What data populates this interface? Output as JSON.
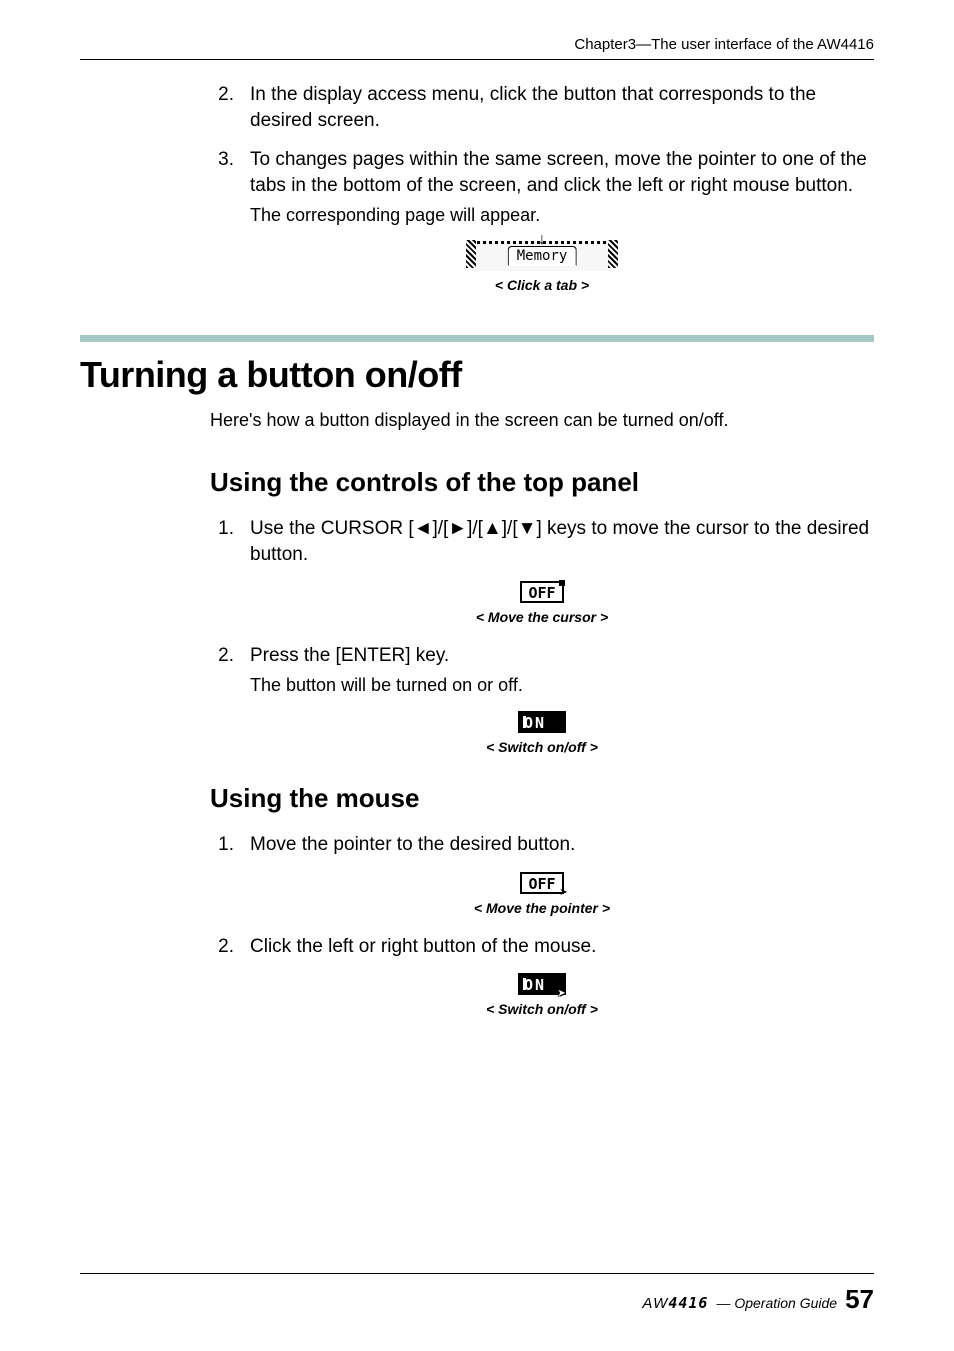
{
  "header": {
    "chapter": "Chapter3—The user interface of the AW4416"
  },
  "pre_steps": [
    {
      "num": "2.",
      "text": "In the display access menu, click the button that corresponds to the desired screen."
    },
    {
      "num": "3.",
      "text": "To changes pages within the same screen, move the pointer to one of the tabs in the bottom of the screen, and click the left or right mouse button.",
      "sub": "The corresponding page will appear."
    }
  ],
  "fig_tab": {
    "label": "Memory",
    "caption": "< Click a tab >"
  },
  "section": {
    "title": "Turning a button on/off",
    "intro": "Here's how a button displayed in the screen can be turned on/off."
  },
  "sub1": {
    "title": "Using the controls of the top panel",
    "steps": [
      {
        "num": "1.",
        "pre": "Use the CURSOR [",
        "mid": "]/[",
        "mid2": "]/[",
        "mid3": "]/[",
        "post": "] keys to move the cursor to the desired button."
      },
      {
        "num": "2.",
        "text": "Press the [ENTER] key.",
        "sub": "The button will be turned on or off."
      }
    ],
    "fig_off": {
      "label": "OFF",
      "caption": "< Move the cursor >"
    },
    "fig_on": {
      "label": "ON",
      "caption": "< Switch on/off >"
    }
  },
  "sub2": {
    "title": "Using the mouse",
    "steps": [
      {
        "num": "1.",
        "text": "Move the pointer to the desired button."
      },
      {
        "num": "2.",
        "text": "Click the left or right button of the mouse."
      }
    ],
    "fig_off": {
      "label": "OFF",
      "caption": "< Move the pointer >"
    },
    "fig_on": {
      "label": "ON",
      "caption": "< Switch on/off >"
    }
  },
  "footer": {
    "product_a": "AW",
    "product_b": "4416",
    "guide": " — Operation Guide",
    "page": "57"
  }
}
